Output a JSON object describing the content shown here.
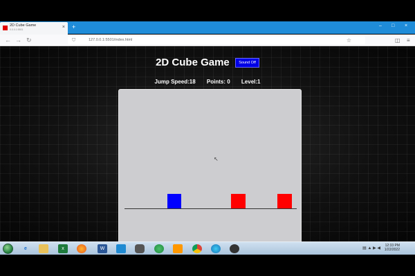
{
  "browser": {
    "tab_title": "2D Cube Game",
    "tab_subtitle": "0.0.0.1:5501",
    "tab_close": "×",
    "new_tab": "+",
    "url": "127.0.0.1:5501/index.html",
    "window_controls": {
      "minimize": "–",
      "maximize": "□",
      "close": "×"
    }
  },
  "game": {
    "title": "2D Cube Game",
    "sound_button_label": "Sound Off",
    "stats": {
      "jump_speed": "Jump Speed:18",
      "points": "Points: 0",
      "level": "Level:1"
    },
    "colors": {
      "player": "#0000ff",
      "obstacle": "#ff0000",
      "sound_button": "#0000e6",
      "game_area": "#cdcdd0"
    },
    "obstacle_count": 2
  },
  "taskbar": {
    "clock_time": "12:33 PM",
    "clock_date": "1/22/2022",
    "icons": [
      "start-orb",
      "ie-icon",
      "file-explorer-icon",
      "excel-icon",
      "firefox-icon",
      "word-icon",
      "vscode-icon",
      "app-icon",
      "chrome-icon",
      "sublime-icon",
      "chrome-alt-icon",
      "edge-icon",
      "obs-icon"
    ]
  }
}
